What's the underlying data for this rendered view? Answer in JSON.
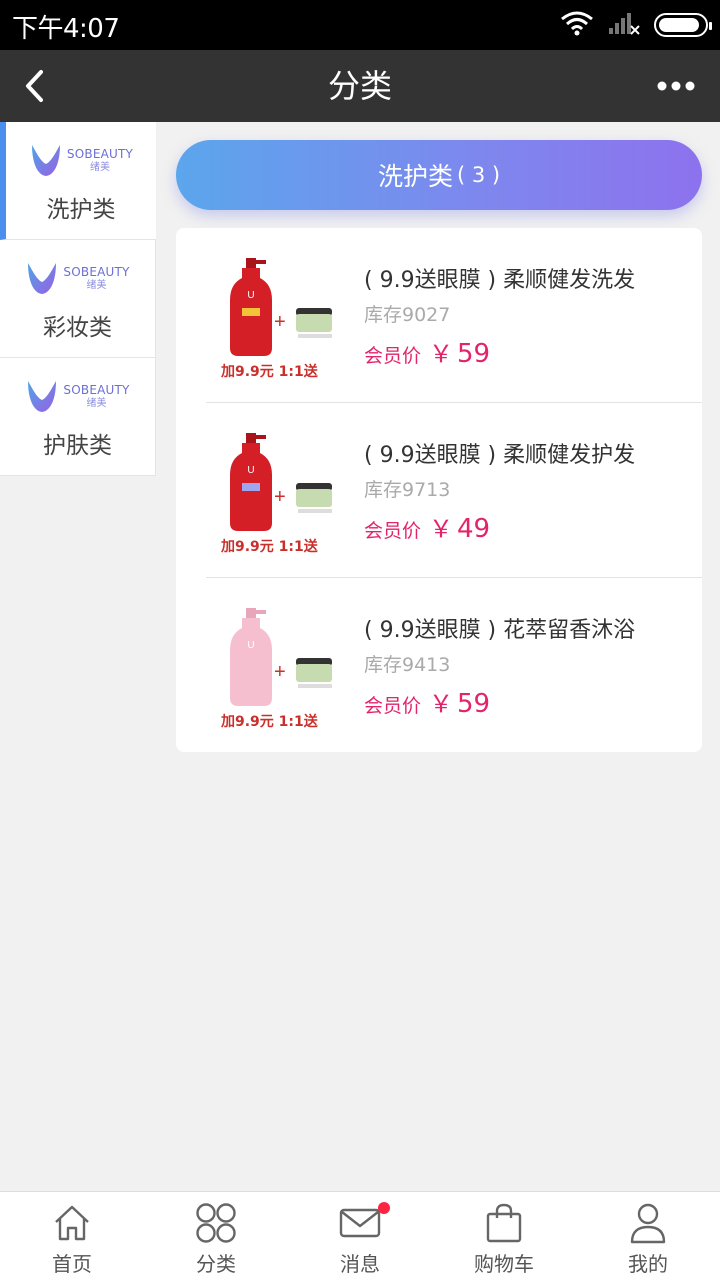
{
  "status": {
    "time": "下午4:07",
    "battery_level": 0.9
  },
  "header": {
    "title": "分类",
    "back_icon": "chevron-left-icon",
    "more_icon": "more-horizontal-icon"
  },
  "brand": {
    "en": "SOBEAUTY",
    "cn": "绪美"
  },
  "sidebar": {
    "items": [
      {
        "label": "洗护类",
        "active": true
      },
      {
        "label": "彩妆类",
        "active": false
      },
      {
        "label": "护肤类",
        "active": false
      }
    ]
  },
  "section": {
    "title": "洗护类",
    "count": "( 3 )"
  },
  "products": [
    {
      "name": "( 9.9送眼膜 ) 柔顺健发洗发",
      "stock": "库存9027",
      "price_label": "会员价",
      "currency": "￥",
      "price": "59",
      "promo": "加9.9元  1:1送",
      "bottle_color": "#d41f26"
    },
    {
      "name": "( 9.9送眼膜 ) 柔顺健发护发",
      "stock": "库存9713",
      "price_label": "会员价",
      "currency": "￥",
      "price": "49",
      "promo": "加9.9元  1:1送",
      "bottle_color": "#d41f26"
    },
    {
      "name": "( 9.9送眼膜 ) 花萃留香沐浴",
      "stock": "库存9413",
      "price_label": "会员价",
      "currency": "￥",
      "price": "59",
      "promo": "加9.9元  1:1送",
      "bottle_color": "#f6bfd0"
    }
  ],
  "tabbar": {
    "items": [
      {
        "label": "首页",
        "icon": "home-icon"
      },
      {
        "label": "分类",
        "icon": "category-icon"
      },
      {
        "label": "消息",
        "icon": "mail-icon",
        "badge": true
      },
      {
        "label": "购物车",
        "icon": "shopping-bag-icon"
      },
      {
        "label": "我的",
        "icon": "user-icon"
      }
    ]
  },
  "colors": {
    "accent": "#4b8eeb",
    "price": "#e3246b",
    "header": "#333333",
    "badge": "#ff2442"
  }
}
